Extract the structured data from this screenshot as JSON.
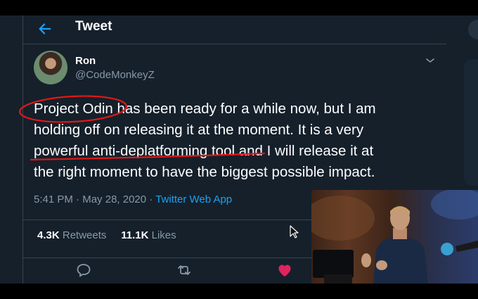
{
  "header": {
    "title": "Tweet"
  },
  "tweet": {
    "display_name": "Ron",
    "handle": "@CodeMonkeyZ",
    "text_lines": [
      "Project Odin has been ready for a while now, but I am",
      "holding off on releasing it at the moment. It is a very",
      "powerful anti-deplatforming tool and I will release it at",
      "the right moment to have the biggest possible impact."
    ],
    "time": "5:41 PM",
    "dot1": " · ",
    "date": "May 28, 2020",
    "dot2": " · ",
    "source": "Twitter Web App",
    "retweets_count": "4.3K",
    "retweets_label": "Retweets",
    "likes_count": "11.1K",
    "likes_label": "Likes"
  },
  "icons": {
    "back": "arrow-left-icon",
    "caret": "chevron-down-icon",
    "reply": "reply-icon",
    "retweet": "retweet-icon",
    "like": "heart-icon",
    "cursor": "mouse-pointer-icon"
  },
  "colors": {
    "background": "#15202b",
    "accent": "#1da1f2",
    "like": "#e0245e",
    "annotation": "#e01818"
  }
}
